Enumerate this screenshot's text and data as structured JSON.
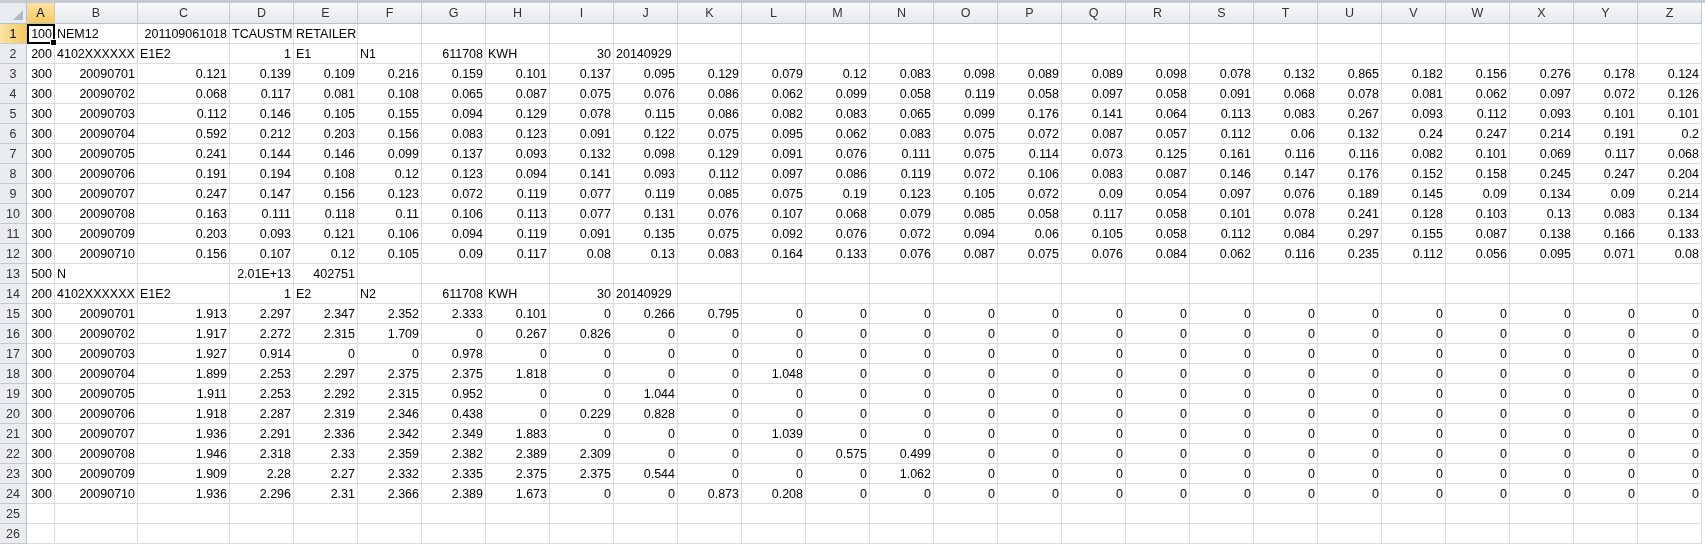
{
  "sheet": {
    "columns": [
      {
        "label": "A",
        "selected": true
      },
      {
        "label": "B",
        "selected": false
      },
      {
        "label": "C",
        "selected": false
      },
      {
        "label": "D",
        "selected": false
      },
      {
        "label": "E",
        "selected": false
      },
      {
        "label": "F",
        "selected": false
      },
      {
        "label": "G",
        "selected": false
      },
      {
        "label": "H",
        "selected": false
      },
      {
        "label": "I",
        "selected": false
      },
      {
        "label": "J",
        "selected": false
      },
      {
        "label": "K",
        "selected": false
      },
      {
        "label": "L",
        "selected": false
      },
      {
        "label": "M",
        "selected": false
      },
      {
        "label": "N",
        "selected": false
      },
      {
        "label": "O",
        "selected": false
      },
      {
        "label": "P",
        "selected": false
      },
      {
        "label": "Q",
        "selected": false
      },
      {
        "label": "R",
        "selected": false
      },
      {
        "label": "S",
        "selected": false
      },
      {
        "label": "T",
        "selected": false
      },
      {
        "label": "U",
        "selected": false
      },
      {
        "label": "V",
        "selected": false
      },
      {
        "label": "W",
        "selected": false
      },
      {
        "label": "X",
        "selected": false
      },
      {
        "label": "Y",
        "selected": false
      },
      {
        "label": "Z",
        "selected": false
      }
    ],
    "rows": [
      {
        "label": "1",
        "selected": true,
        "cells": [
          {
            "text": "100",
            "kind": "number",
            "selected": true
          },
          {
            "text": "NEM12",
            "kind": "text"
          },
          "201109061018",
          {
            "text": "TCAUSTM",
            "kind": "text"
          },
          {
            "text": "RETAILER",
            "kind": "text"
          }
        ]
      },
      {
        "label": "2",
        "selected": false,
        "cells": [
          "200",
          {
            "text": "4102XXXXXX",
            "kind": "text"
          },
          {
            "text": "E1E2",
            "kind": "text"
          },
          "1",
          {
            "text": "E1",
            "kind": "text"
          },
          {
            "text": "N1",
            "kind": "text"
          },
          "611708",
          {
            "text": "KWH",
            "kind": "text"
          },
          "30",
          {
            "text": "20140929",
            "kind": "text"
          }
        ]
      },
      {
        "label": "3",
        "selected": false,
        "cells": [
          "300",
          "20090701",
          "0.121",
          "0.139",
          "0.109",
          "0.216",
          "0.159",
          "0.101",
          "0.137",
          "0.095",
          "0.129",
          "0.079",
          "0.12",
          "0.083",
          "0.098",
          "0.089",
          "0.089",
          "0.098",
          "0.078",
          "0.132",
          "0.865",
          "0.182",
          "0.156",
          "0.276",
          "0.178",
          "0.124"
        ]
      },
      {
        "label": "4",
        "selected": false,
        "cells": [
          "300",
          "20090702",
          "0.068",
          "0.117",
          "0.081",
          "0.108",
          "0.065",
          "0.087",
          "0.075",
          "0.076",
          "0.086",
          "0.062",
          "0.099",
          "0.058",
          "0.119",
          "0.058",
          "0.097",
          "0.058",
          "0.091",
          "0.068",
          "0.078",
          "0.081",
          "0.062",
          "0.097",
          "0.072",
          "0.126"
        ]
      },
      {
        "label": "5",
        "selected": false,
        "cells": [
          "300",
          "20090703",
          "0.112",
          "0.146",
          "0.105",
          "0.155",
          "0.094",
          "0.129",
          "0.078",
          "0.115",
          "0.086",
          "0.082",
          "0.083",
          "0.065",
          "0.099",
          "0.176",
          "0.141",
          "0.064",
          "0.113",
          "0.083",
          "0.267",
          "0.093",
          "0.112",
          "0.093",
          "0.101",
          "0.101"
        ]
      },
      {
        "label": "6",
        "selected": false,
        "cells": [
          "300",
          "20090704",
          "0.592",
          "0.212",
          "0.203",
          "0.156",
          "0.083",
          "0.123",
          "0.091",
          "0.122",
          "0.075",
          "0.095",
          "0.062",
          "0.083",
          "0.075",
          "0.072",
          "0.087",
          "0.057",
          "0.112",
          "0.06",
          "0.132",
          "0.24",
          "0.247",
          "0.214",
          "0.191",
          "0.2"
        ]
      },
      {
        "label": "7",
        "selected": false,
        "cells": [
          "300",
          "20090705",
          "0.241",
          "0.144",
          "0.146",
          "0.099",
          "0.137",
          "0.093",
          "0.132",
          "0.098",
          "0.129",
          "0.091",
          "0.076",
          "0.111",
          "0.075",
          "0.114",
          "0.073",
          "0.125",
          "0.161",
          "0.116",
          "0.116",
          "0.082",
          "0.101",
          "0.069",
          "0.117",
          "0.068"
        ]
      },
      {
        "label": "8",
        "selected": false,
        "cells": [
          "300",
          "20090706",
          "0.191",
          "0.194",
          "0.108",
          "0.12",
          "0.123",
          "0.094",
          "0.141",
          "0.093",
          "0.112",
          "0.097",
          "0.086",
          "0.119",
          "0.072",
          "0.106",
          "0.083",
          "0.087",
          "0.146",
          "0.147",
          "0.176",
          "0.152",
          "0.158",
          "0.245",
          "0.247",
          "0.204"
        ]
      },
      {
        "label": "9",
        "selected": false,
        "cells": [
          "300",
          "20090707",
          "0.247",
          "0.147",
          "0.156",
          "0.123",
          "0.072",
          "0.119",
          "0.077",
          "0.119",
          "0.085",
          "0.075",
          "0.19",
          "0.123",
          "0.105",
          "0.072",
          "0.09",
          "0.054",
          "0.097",
          "0.076",
          "0.189",
          "0.145",
          "0.09",
          "0.134",
          "0.09",
          "0.214"
        ]
      },
      {
        "label": "10",
        "selected": false,
        "cells": [
          "300",
          "20090708",
          "0.163",
          "0.111",
          "0.118",
          "0.11",
          "0.106",
          "0.113",
          "0.077",
          "0.131",
          "0.076",
          "0.107",
          "0.068",
          "0.079",
          "0.085",
          "0.058",
          "0.117",
          "0.058",
          "0.101",
          "0.078",
          "0.241",
          "0.128",
          "0.103",
          "0.13",
          "0.083",
          "0.134"
        ]
      },
      {
        "label": "11",
        "selected": false,
        "cells": [
          "300",
          "20090709",
          "0.203",
          "0.093",
          "0.121",
          "0.106",
          "0.094",
          "0.119",
          "0.091",
          "0.135",
          "0.075",
          "0.092",
          "0.076",
          "0.072",
          "0.094",
          "0.06",
          "0.105",
          "0.058",
          "0.112",
          "0.084",
          "0.297",
          "0.155",
          "0.087",
          "0.138",
          "0.166",
          "0.133"
        ]
      },
      {
        "label": "12",
        "selected": false,
        "cells": [
          "300",
          "20090710",
          "0.156",
          "0.107",
          "0.12",
          "0.105",
          "0.09",
          "0.117",
          "0.08",
          "0.13",
          "0.083",
          "0.164",
          "0.133",
          "0.076",
          "0.087",
          "0.075",
          "0.076",
          "0.084",
          "0.062",
          "0.116",
          "0.235",
          "0.112",
          "0.056",
          "0.095",
          "0.071",
          "0.08"
        ]
      },
      {
        "label": "13",
        "selected": false,
        "cells": [
          "500",
          {
            "text": "N",
            "kind": "text"
          },
          null,
          "2.01E+13",
          "402751"
        ]
      },
      {
        "label": "14",
        "selected": false,
        "cells": [
          "200",
          {
            "text": "4102XXXXXX",
            "kind": "text"
          },
          {
            "text": "E1E2",
            "kind": "text"
          },
          "1",
          {
            "text": "E2",
            "kind": "text"
          },
          {
            "text": "N2",
            "kind": "text"
          },
          "611708",
          {
            "text": "KWH",
            "kind": "text"
          },
          "30",
          {
            "text": "20140929",
            "kind": "text"
          }
        ]
      },
      {
        "label": "15",
        "selected": false,
        "cells": [
          "300",
          "20090701",
          "1.913",
          "2.297",
          "2.347",
          "2.352",
          "2.333",
          "0.101",
          "0",
          "0.266",
          "0.795",
          "0",
          "0",
          "0",
          "0",
          "0",
          "0",
          "0",
          "0",
          "0",
          "0",
          "0",
          "0",
          "0",
          "0",
          "0"
        ]
      },
      {
        "label": "16",
        "selected": false,
        "cells": [
          "300",
          "20090702",
          "1.917",
          "2.272",
          "2.315",
          "1.709",
          "0",
          "0.267",
          "0.826",
          "0",
          "0",
          "0",
          "0",
          "0",
          "0",
          "0",
          "0",
          "0",
          "0",
          "0",
          "0",
          "0",
          "0",
          "0",
          "0",
          "0"
        ]
      },
      {
        "label": "17",
        "selected": false,
        "cells": [
          "300",
          "20090703",
          "1.927",
          "0.914",
          "0",
          "0",
          "0.978",
          "0",
          "0",
          "0",
          "0",
          "0",
          "0",
          "0",
          "0",
          "0",
          "0",
          "0",
          "0",
          "0",
          "0",
          "0",
          "0",
          "0",
          "0",
          "0"
        ]
      },
      {
        "label": "18",
        "selected": false,
        "cells": [
          "300",
          "20090704",
          "1.899",
          "2.253",
          "2.297",
          "2.375",
          "2.375",
          "1.818",
          "0",
          "0",
          "0",
          "1.048",
          "0",
          "0",
          "0",
          "0",
          "0",
          "0",
          "0",
          "0",
          "0",
          "0",
          "0",
          "0",
          "0",
          "0"
        ]
      },
      {
        "label": "19",
        "selected": false,
        "cells": [
          "300",
          "20090705",
          "1.911",
          "2.253",
          "2.292",
          "2.315",
          "0.952",
          "0",
          "0",
          "1.044",
          "0",
          "0",
          "0",
          "0",
          "0",
          "0",
          "0",
          "0",
          "0",
          "0",
          "0",
          "0",
          "0",
          "0",
          "0",
          "0"
        ]
      },
      {
        "label": "20",
        "selected": false,
        "cells": [
          "300",
          "20090706",
          "1.918",
          "2.287",
          "2.319",
          "2.346",
          "0.438",
          "0",
          "0.229",
          "0.828",
          "0",
          "0",
          "0",
          "0",
          "0",
          "0",
          "0",
          "0",
          "0",
          "0",
          "0",
          "0",
          "0",
          "0",
          "0",
          "0"
        ]
      },
      {
        "label": "21",
        "selected": false,
        "cells": [
          "300",
          "20090707",
          "1.936",
          "2.291",
          "2.336",
          "2.342",
          "2.349",
          "1.883",
          "0",
          "0",
          "0",
          "1.039",
          "0",
          "0",
          "0",
          "0",
          "0",
          "0",
          "0",
          "0",
          "0",
          "0",
          "0",
          "0",
          "0",
          "0"
        ]
      },
      {
        "label": "22",
        "selected": false,
        "cells": [
          "300",
          "20090708",
          "1.946",
          "2.318",
          "2.33",
          "2.359",
          "2.382",
          "2.389",
          "2.309",
          "0",
          "0",
          "0",
          "0.575",
          "0.499",
          "0",
          "0",
          "0",
          "0",
          "0",
          "0",
          "0",
          "0",
          "0",
          "0",
          "0",
          "0"
        ]
      },
      {
        "label": "23",
        "selected": false,
        "cells": [
          "300",
          "20090709",
          "1.909",
          "2.28",
          "2.27",
          "2.332",
          "2.335",
          "2.375",
          "2.375",
          "0.544",
          "0",
          "0",
          "0",
          "1.062",
          "0",
          "0",
          "0",
          "0",
          "0",
          "0",
          "0",
          "0",
          "0",
          "0",
          "0",
          "0"
        ]
      },
      {
        "label": "24",
        "selected": false,
        "cells": [
          "300",
          "20090710",
          "1.936",
          "2.296",
          "2.31",
          "2.366",
          "2.389",
          "1.673",
          "0",
          "0",
          "0.873",
          "0.208",
          "0",
          "0",
          "0",
          "0",
          "0",
          "0",
          "0",
          "0",
          "0",
          "0",
          "0",
          "0",
          "0",
          "0"
        ]
      },
      {
        "label": "25",
        "selected": false
      },
      {
        "label": "26",
        "selected": false
      }
    ]
  }
}
